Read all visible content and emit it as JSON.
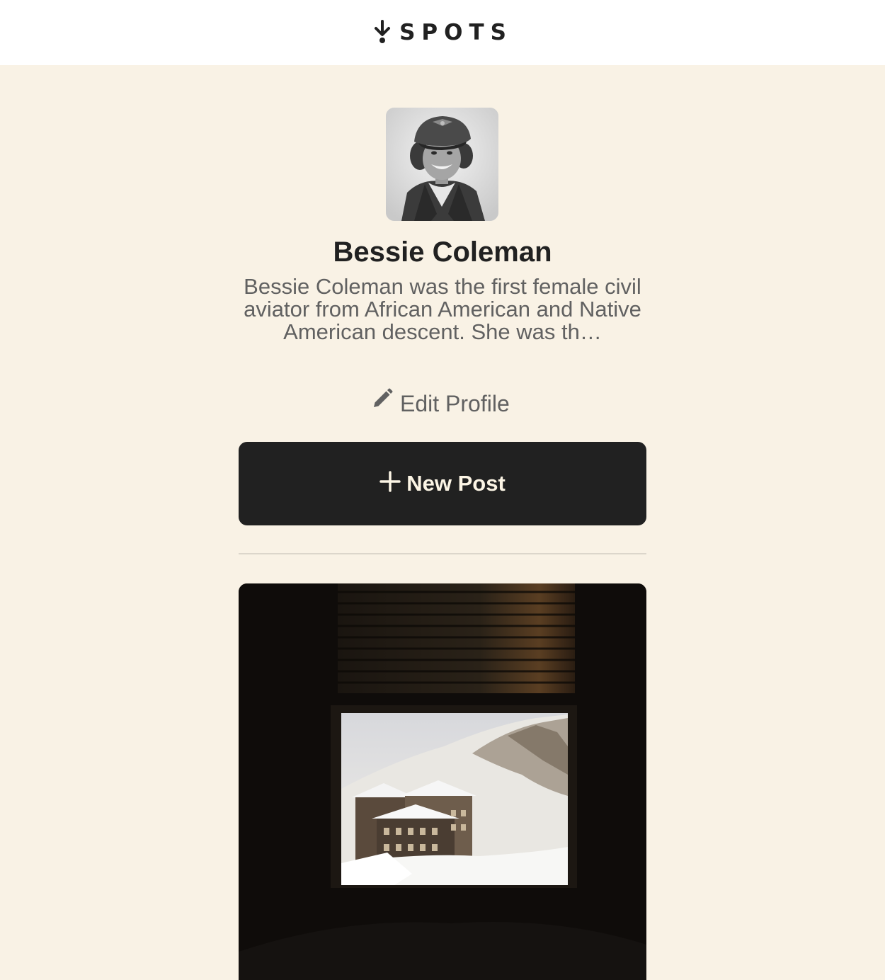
{
  "header": {
    "logo_text": "SPOTS",
    "logo_icon": "arrow-down-dot-icon"
  },
  "profile": {
    "name": "Bessie Coleman",
    "description": "Bessie Coleman was the first female civil aviator from African American and Native American descent. She was th…",
    "avatar_icon": "avatar-photo",
    "edit_label": "Edit Profile",
    "edit_icon": "pencil-icon"
  },
  "actions": {
    "new_post_label": "New Post",
    "new_post_icon": "plus-icon"
  },
  "posts": [
    {
      "image": "window-view-of-snowy-mountain-village"
    }
  ],
  "colors": {
    "page_background": "#f9f2e5",
    "header_background": "#ffffff",
    "primary_text": "#212121",
    "secondary_text": "#616161",
    "button_background": "#212121",
    "button_text": "#fcf5e5"
  }
}
